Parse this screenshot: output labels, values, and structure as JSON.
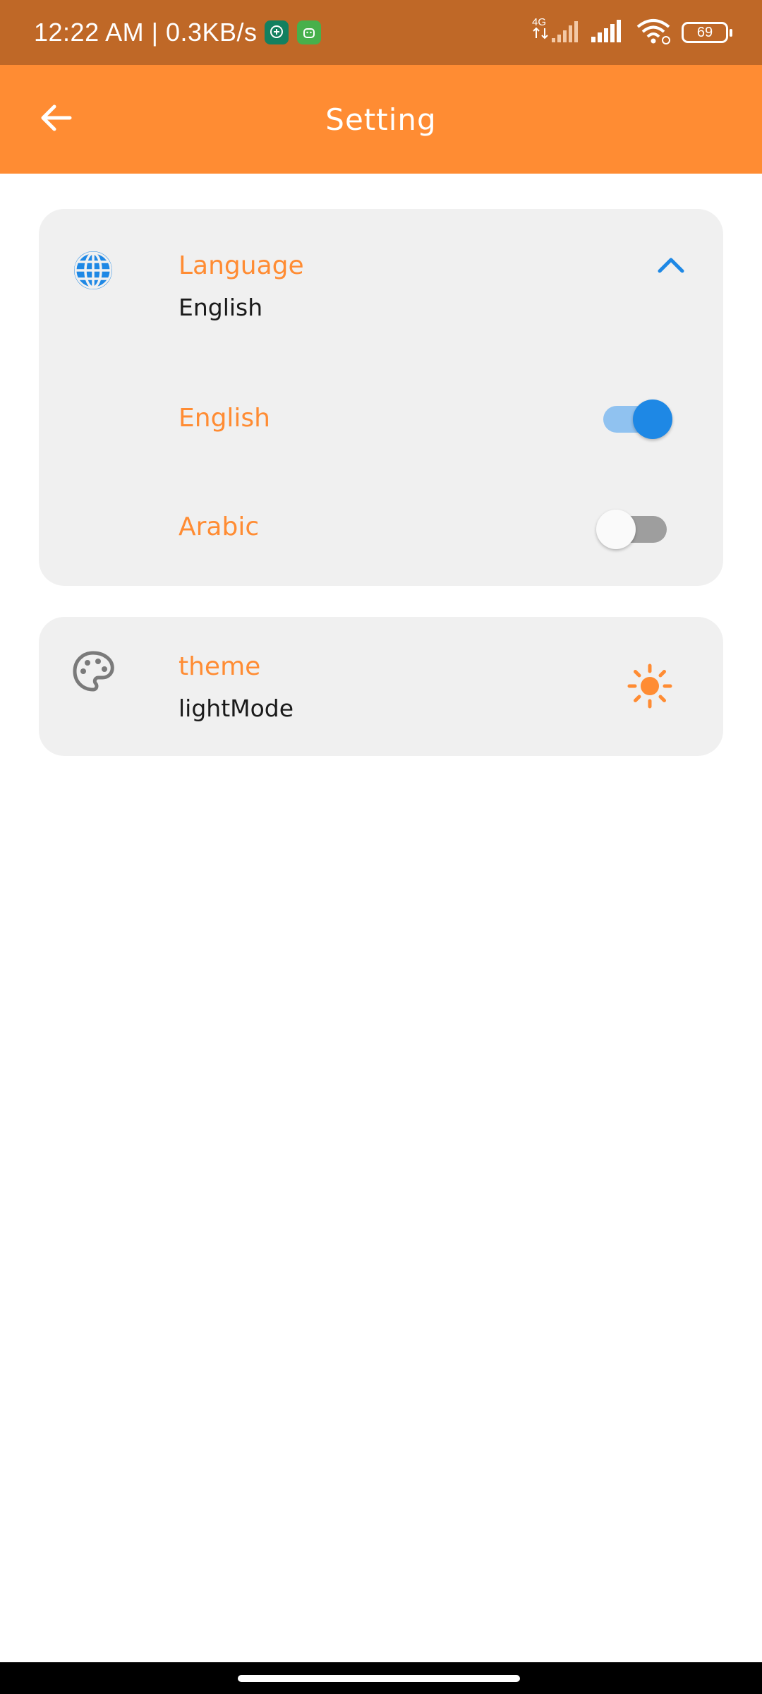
{
  "status_bar": {
    "time_speed": "12:22 AM | 0.3KB/s",
    "network": "4G",
    "battery": "69"
  },
  "app_bar": {
    "title": "Setting"
  },
  "language_card": {
    "title": "Language",
    "current": "English",
    "options": [
      {
        "label": "English",
        "selected": true
      },
      {
        "label": "Arabic",
        "selected": false
      }
    ]
  },
  "theme_card": {
    "title": "theme",
    "current": "lightMode"
  },
  "colors": {
    "status_bar": "#bf6827",
    "app_bar": "#ff8c33",
    "accent_orange": "#ff8c33",
    "accent_blue": "#1e88e5",
    "card_bg": "#f0f0f0"
  },
  "icons": {
    "back": "arrow-back-icon",
    "language": "globe-icon",
    "expand": "chevron-up-icon",
    "theme": "palette-icon",
    "mode": "sun-icon"
  }
}
